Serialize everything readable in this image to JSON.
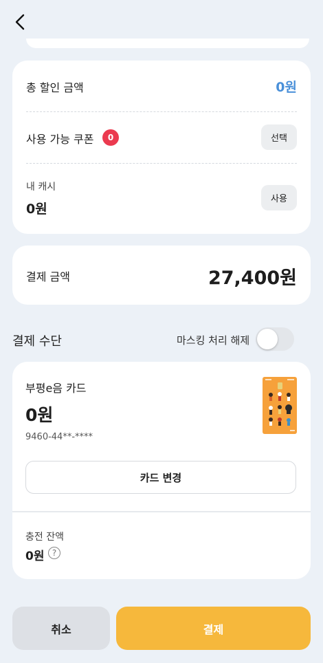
{
  "discount": {
    "total_label": "총 할인 금액",
    "total_value": "0원",
    "coupon_label": "사용 가능 쿠폰",
    "coupon_count": "0",
    "coupon_button": "선택",
    "cash_label": "내 캐시",
    "cash_value": "0원",
    "cash_button": "사용"
  },
  "payment_amount": {
    "label": "결제 금액",
    "value": "27,400원"
  },
  "method": {
    "title": "결제 수단",
    "masking_label": "마스킹 처리 해제",
    "masking_on": false
  },
  "card": {
    "name": "부평e음 카드",
    "balance": "0원",
    "number": "9460-44**-****",
    "change_button": "카드 변경",
    "charge_label": "충전 잔액",
    "charge_value": "0원",
    "help_symbol": "?"
  },
  "footer": {
    "cancel": "취소",
    "pay": "결제"
  },
  "colors": {
    "accent_blue": "#4a90d9",
    "badge_red": "#eb3a4f",
    "pay_yellow": "#f6b83c",
    "card_orange": "#f6a13b"
  }
}
